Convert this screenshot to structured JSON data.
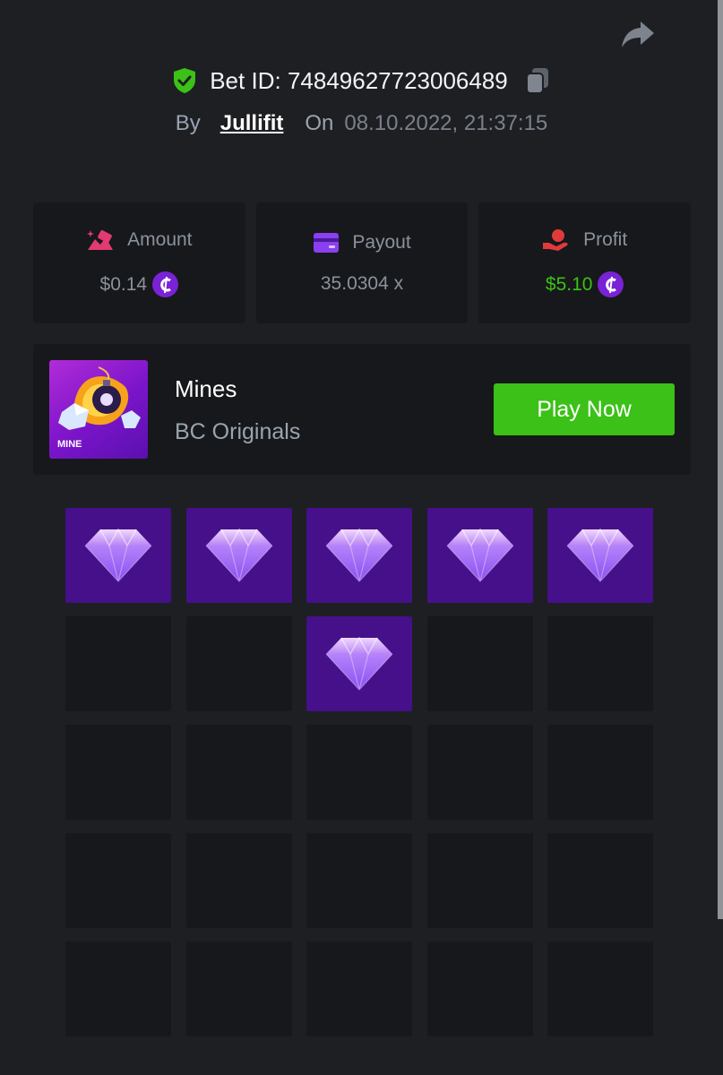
{
  "header": {
    "bet_label": "Bet ID:",
    "bet_id": "74849627723006489",
    "by_label": "By",
    "username": "Jullifit",
    "on_label": "On",
    "datetime": "08.10.2022, 21:37:15"
  },
  "stats": {
    "amount": {
      "label": "Amount",
      "value": "$0.14",
      "currency_icon": "bc-coin-icon"
    },
    "payout": {
      "label": "Payout",
      "value": "35.0304 x"
    },
    "profit": {
      "label": "Profit",
      "value": "$5.10",
      "currency_icon": "bc-coin-icon"
    }
  },
  "game": {
    "name": "Mines",
    "provider": "BC Originals",
    "thumb_label": "MINE",
    "play_label": "Play Now"
  },
  "board": {
    "rows": 5,
    "cols": 5,
    "tiles": [
      "gem",
      "gem",
      "gem",
      "gem",
      "gem",
      "hidden",
      "hidden",
      "gem",
      "hidden",
      "hidden",
      "hidden",
      "hidden",
      "hidden",
      "hidden",
      "hidden",
      "hidden",
      "hidden",
      "hidden",
      "hidden",
      "hidden",
      "hidden",
      "hidden",
      "hidden",
      "hidden",
      "hidden"
    ]
  },
  "colors": {
    "background": "#1e1f23",
    "panel": "#17181b",
    "accent_green": "#3bc117",
    "gem_tile": "#45108a",
    "coin_purple": "#7a22d6"
  }
}
